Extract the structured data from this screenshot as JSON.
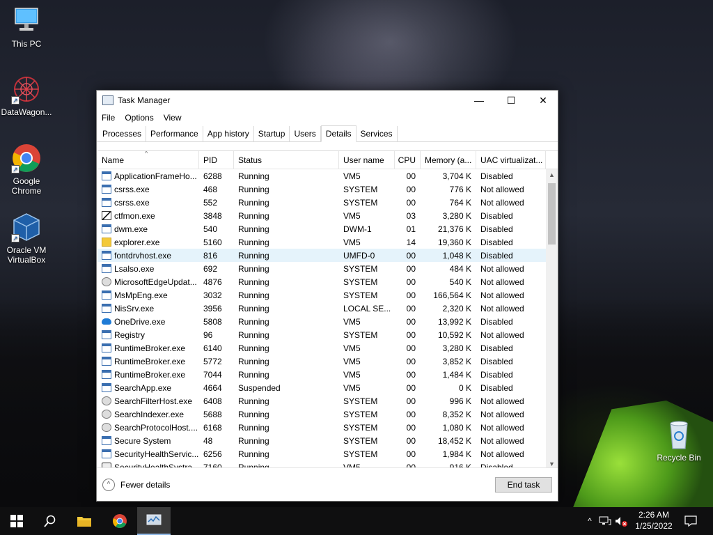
{
  "desktop": {
    "icons": [
      {
        "label": "This PC"
      },
      {
        "label": "DataWagon..."
      },
      {
        "label": "Google Chrome"
      },
      {
        "label": "Oracle VM VirtualBox"
      },
      {
        "label": "Recycle Bin"
      }
    ]
  },
  "window": {
    "title": "Task Manager",
    "controls": {
      "minimize": "—",
      "maximize": "☐",
      "close": "✕"
    },
    "menu": [
      "File",
      "Options",
      "View"
    ],
    "tabs": [
      "Processes",
      "Performance",
      "App history",
      "Startup",
      "Users",
      "Details",
      "Services"
    ],
    "active_tab": "Details",
    "columns": [
      "Name",
      "PID",
      "Status",
      "User name",
      "CPU",
      "Memory (a...",
      "UAC virtualizat..."
    ],
    "rows": [
      {
        "name": "ApplicationFrameHo...",
        "pid": "6288",
        "status": "Running",
        "user": "VM5",
        "cpu": "00",
        "mem": "3,704 K",
        "uac": "Disabled",
        "icon": "window-icon"
      },
      {
        "name": "csrss.exe",
        "pid": "468",
        "status": "Running",
        "user": "SYSTEM",
        "cpu": "00",
        "mem": "776 K",
        "uac": "Not allowed",
        "icon": "window-icon"
      },
      {
        "name": "csrss.exe",
        "pid": "552",
        "status": "Running",
        "user": "SYSTEM",
        "cpu": "00",
        "mem": "764 K",
        "uac": "Not allowed",
        "icon": "window-icon"
      },
      {
        "name": "ctfmon.exe",
        "pid": "3848",
        "status": "Running",
        "user": "VM5",
        "cpu": "03",
        "mem": "3,280 K",
        "uac": "Disabled",
        "icon": "pen-icon"
      },
      {
        "name": "dwm.exe",
        "pid": "540",
        "status": "Running",
        "user": "DWM-1",
        "cpu": "01",
        "mem": "21,376 K",
        "uac": "Disabled",
        "icon": "window-icon"
      },
      {
        "name": "explorer.exe",
        "pid": "5160",
        "status": "Running",
        "user": "VM5",
        "cpu": "14",
        "mem": "19,360 K",
        "uac": "Disabled",
        "icon": "folder-icon"
      },
      {
        "name": "fontdrvhost.exe",
        "pid": "816",
        "status": "Running",
        "user": "UMFD-0",
        "cpu": "00",
        "mem": "1,048 K",
        "uac": "Disabled",
        "icon": "window-icon"
      },
      {
        "name": "Lsalso.exe",
        "pid": "692",
        "status": "Running",
        "user": "SYSTEM",
        "cpu": "00",
        "mem": "484 K",
        "uac": "Not allowed",
        "icon": "window-icon"
      },
      {
        "name": "MicrosoftEdgeUpdat...",
        "pid": "4876",
        "status": "Running",
        "user": "SYSTEM",
        "cpu": "00",
        "mem": "540 K",
        "uac": "Not allowed",
        "icon": "gear-icon"
      },
      {
        "name": "MsMpEng.exe",
        "pid": "3032",
        "status": "Running",
        "user": "SYSTEM",
        "cpu": "00",
        "mem": "166,564 K",
        "uac": "Not allowed",
        "icon": "window-icon"
      },
      {
        "name": "NisSrv.exe",
        "pid": "3956",
        "status": "Running",
        "user": "LOCAL SE...",
        "cpu": "00",
        "mem": "2,320 K",
        "uac": "Not allowed",
        "icon": "window-icon"
      },
      {
        "name": "OneDrive.exe",
        "pid": "5808",
        "status": "Running",
        "user": "VM5",
        "cpu": "00",
        "mem": "13,992 K",
        "uac": "Disabled",
        "icon": "cloud-icon"
      },
      {
        "name": "Registry",
        "pid": "96",
        "status": "Running",
        "user": "SYSTEM",
        "cpu": "00",
        "mem": "10,592 K",
        "uac": "Not allowed",
        "icon": "window-icon"
      },
      {
        "name": "RuntimeBroker.exe",
        "pid": "6140",
        "status": "Running",
        "user": "VM5",
        "cpu": "00",
        "mem": "3,280 K",
        "uac": "Disabled",
        "icon": "window-icon"
      },
      {
        "name": "RuntimeBroker.exe",
        "pid": "5772",
        "status": "Running",
        "user": "VM5",
        "cpu": "00",
        "mem": "3,852 K",
        "uac": "Disabled",
        "icon": "window-icon"
      },
      {
        "name": "RuntimeBroker.exe",
        "pid": "7044",
        "status": "Running",
        "user": "VM5",
        "cpu": "00",
        "mem": "1,484 K",
        "uac": "Disabled",
        "icon": "window-icon"
      },
      {
        "name": "SearchApp.exe",
        "pid": "4664",
        "status": "Suspended",
        "user": "VM5",
        "cpu": "00",
        "mem": "0 K",
        "uac": "Disabled",
        "icon": "window-icon"
      },
      {
        "name": "SearchFilterHost.exe",
        "pid": "6408",
        "status": "Running",
        "user": "SYSTEM",
        "cpu": "00",
        "mem": "996 K",
        "uac": "Not allowed",
        "icon": "search-person-icon"
      },
      {
        "name": "SearchIndexer.exe",
        "pid": "5688",
        "status": "Running",
        "user": "SYSTEM",
        "cpu": "00",
        "mem": "8,352 K",
        "uac": "Not allowed",
        "icon": "search-person-icon"
      },
      {
        "name": "SearchProtocolHost....",
        "pid": "6168",
        "status": "Running",
        "user": "SYSTEM",
        "cpu": "00",
        "mem": "1,080 K",
        "uac": "Not allowed",
        "icon": "search-person-icon"
      },
      {
        "name": "Secure System",
        "pid": "48",
        "status": "Running",
        "user": "SYSTEM",
        "cpu": "00",
        "mem": "18,452 K",
        "uac": "Not allowed",
        "icon": "window-icon"
      },
      {
        "name": "SecurityHealthServic...",
        "pid": "6256",
        "status": "Running",
        "user": "SYSTEM",
        "cpu": "00",
        "mem": "1,984 K",
        "uac": "Not allowed",
        "icon": "window-icon"
      },
      {
        "name": "SecurityHealthSystra...",
        "pid": "7160",
        "status": "Running",
        "user": "VM5",
        "cpu": "00",
        "mem": "916 K",
        "uac": "Disabled",
        "icon": "shield-icon"
      }
    ],
    "selected_row": 6,
    "fewer_details": "Fewer details",
    "end_task": "End task"
  },
  "taskbar": {
    "time": "2:26 AM",
    "date": "1/25/2022"
  }
}
